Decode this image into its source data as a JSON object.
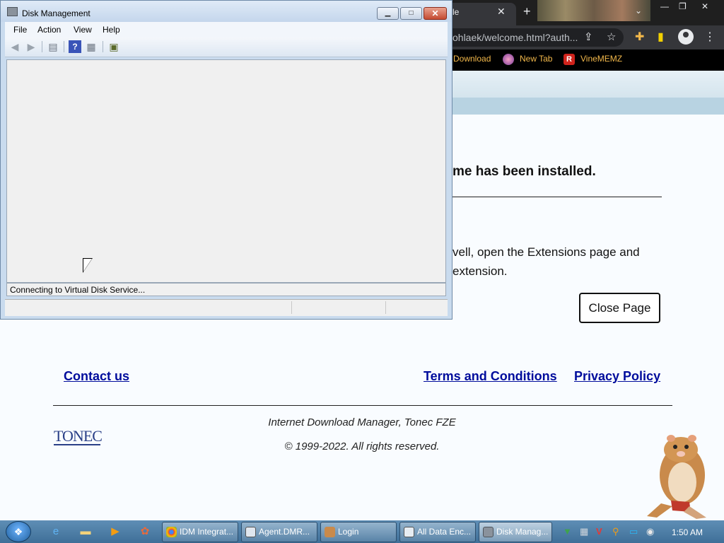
{
  "browser": {
    "tab_title": "le",
    "url": "ohlaek/welcome.html?auth...",
    "bookmarks": [
      {
        "label": "Download"
      },
      {
        "label": "New Tab"
      },
      {
        "label": "VineMEMZ"
      }
    ]
  },
  "page": {
    "heading": "me has been installed.",
    "para_line1": "vell, open the Extensions page and",
    "para_line2": "extension.",
    "close_button": "Close Page",
    "footer": {
      "contact": "Contact us",
      "terms": "Terms and Conditions",
      "privacy": "Privacy Policy",
      "company": "Internet Download Manager, Tonec FZE",
      "copyright": "© 1999-2022. All rights reserved.",
      "logo_text": "TONEC"
    }
  },
  "disk_management": {
    "title": "Disk Management",
    "menu": [
      "File",
      "Action",
      "View",
      "Help"
    ],
    "status": "Connecting to Virtual Disk Service..."
  },
  "taskbar": {
    "tasks": [
      {
        "label": "IDM Integrat..."
      },
      {
        "label": "Agent.DMR..."
      },
      {
        "label": "Login"
      },
      {
        "label": "All Data Enc..."
      },
      {
        "label": "Disk Manag..."
      }
    ],
    "clock": "1:50 AM"
  }
}
